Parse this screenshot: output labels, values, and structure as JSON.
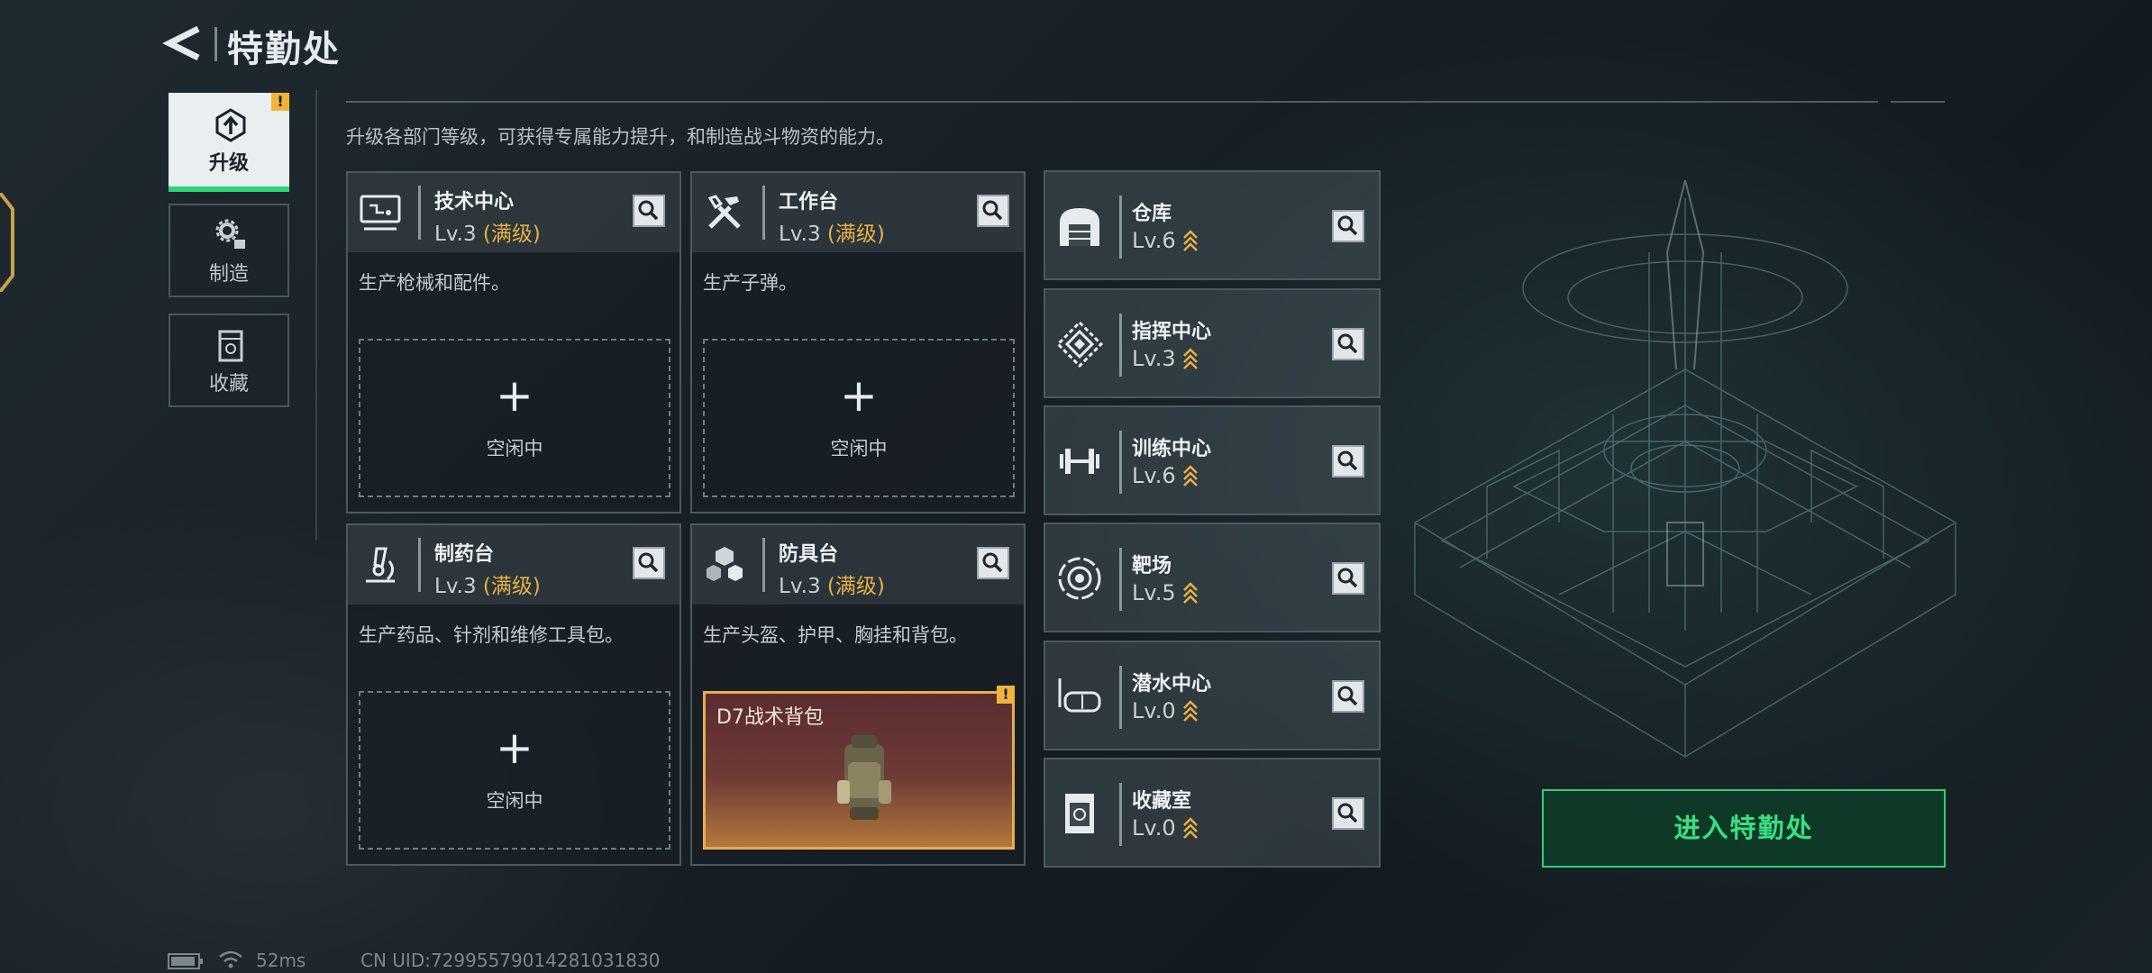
{
  "header": {
    "title": "特勤处"
  },
  "nav": {
    "items": [
      {
        "label": "升级",
        "active": true,
        "alert": "!"
      },
      {
        "label": "制造",
        "active": false
      },
      {
        "label": "收藏",
        "active": false
      }
    ]
  },
  "description": "升级各部门等级，可获得专属能力提升，和制造战斗物资的能力。",
  "departments": [
    {
      "name": "技术中心",
      "level": "Lv.3",
      "max_tag": "(满级)",
      "desc": "生产枪械和配件。",
      "slot_plus": "+",
      "slot_status": "空闲中",
      "icon": "monitor-icon"
    },
    {
      "name": "工作台",
      "level": "Lv.3",
      "max_tag": "(满级)",
      "desc": "生产子弹。",
      "slot_plus": "+",
      "slot_status": "空闲中",
      "icon": "tools-icon"
    },
    {
      "name": "制药台",
      "level": "Lv.3",
      "max_tag": "(满级)",
      "desc": "生产药品、针剂和维修工具包。",
      "slot_plus": "+",
      "slot_status": "空闲中",
      "icon": "microscope-icon"
    },
    {
      "name": "防具台",
      "level": "Lv.3",
      "max_tag": "(满级)",
      "desc": "生产头盔、护甲、胸挂和背包。",
      "product": "D7战术背包",
      "product_alert": "!",
      "icon": "armor-blocks-icon"
    }
  ],
  "facilities": [
    {
      "name": "仓库",
      "level": "Lv.6",
      "icon": "warehouse-icon"
    },
    {
      "name": "指挥中心",
      "level": "Lv.3",
      "icon": "command-icon"
    },
    {
      "name": "训练中心",
      "level": "Lv.6",
      "icon": "dumbbell-icon"
    },
    {
      "name": "靶场",
      "level": "Lv.5",
      "icon": "target-icon"
    },
    {
      "name": "潜水中心",
      "level": "Lv.0",
      "icon": "diving-mask-icon"
    },
    {
      "name": "收藏室",
      "level": "Lv.0",
      "icon": "collection-icon"
    }
  ],
  "enter_button": "进入特勤处",
  "status": {
    "ping": "52ms",
    "uid": "CN UID:72995579014281031830"
  },
  "colors": {
    "accent_green": "#2fd37a",
    "max_gold": "#e6b044",
    "alert_yellow": "#f0b43a"
  }
}
